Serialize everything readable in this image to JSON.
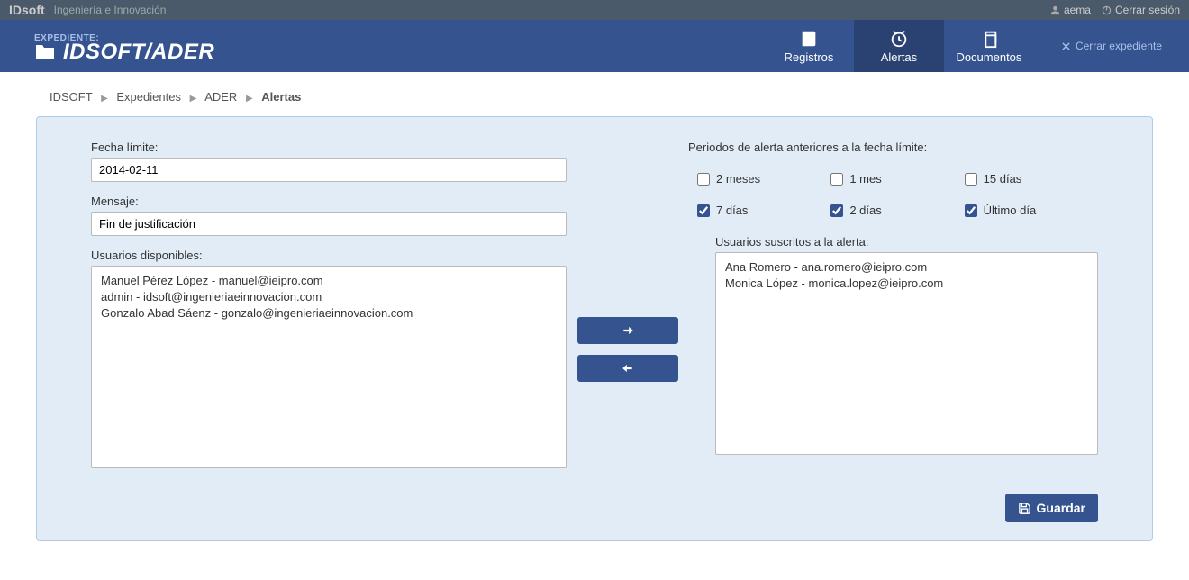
{
  "topbar": {
    "brand": "IDsoft",
    "tagline": "Ingeniería e Innovación",
    "username": "aema",
    "logout": "Cerrar sesión"
  },
  "header": {
    "label": "EXPEDIENTE:",
    "title": "IDSOFT/ADER",
    "nav": {
      "registros": "Registros",
      "alertas": "Alertas",
      "documentos": "Documentos"
    },
    "close": "Cerrar expediente"
  },
  "breadcrumb": {
    "items": [
      "IDSOFT",
      "Expedientes",
      "ADER"
    ],
    "current": "Alertas"
  },
  "form": {
    "fecha_label": "Fecha límite:",
    "fecha_value": "2014-02-11",
    "mensaje_label": "Mensaje:",
    "mensaje_value": "Fin de justificación",
    "disponibles_label": "Usuarios disponibles:",
    "periodos_label": "Periodos de alerta anteriores a la fecha límite:",
    "suscritos_label": "Usuarios suscritos a la alerta:",
    "save": "Guardar"
  },
  "periodos": [
    {
      "label": "2 meses",
      "checked": false
    },
    {
      "label": "1 mes",
      "checked": false
    },
    {
      "label": "15 días",
      "checked": false
    },
    {
      "label": "7 días",
      "checked": true
    },
    {
      "label": "2 días",
      "checked": true
    },
    {
      "label": "Último día",
      "checked": true
    }
  ],
  "usuarios_disponibles": [
    "Manuel Pérez López - manuel@ieipro.com",
    "admin - idsoft@ingenieriaeinnovacion.com",
    "Gonzalo Abad Sáenz - gonzalo@ingenieriaeinnovacion.com"
  ],
  "usuarios_suscritos": [
    "Ana Romero - ana.romero@ieipro.com",
    "Monica López - monica.lopez@ieipro.com"
  ]
}
